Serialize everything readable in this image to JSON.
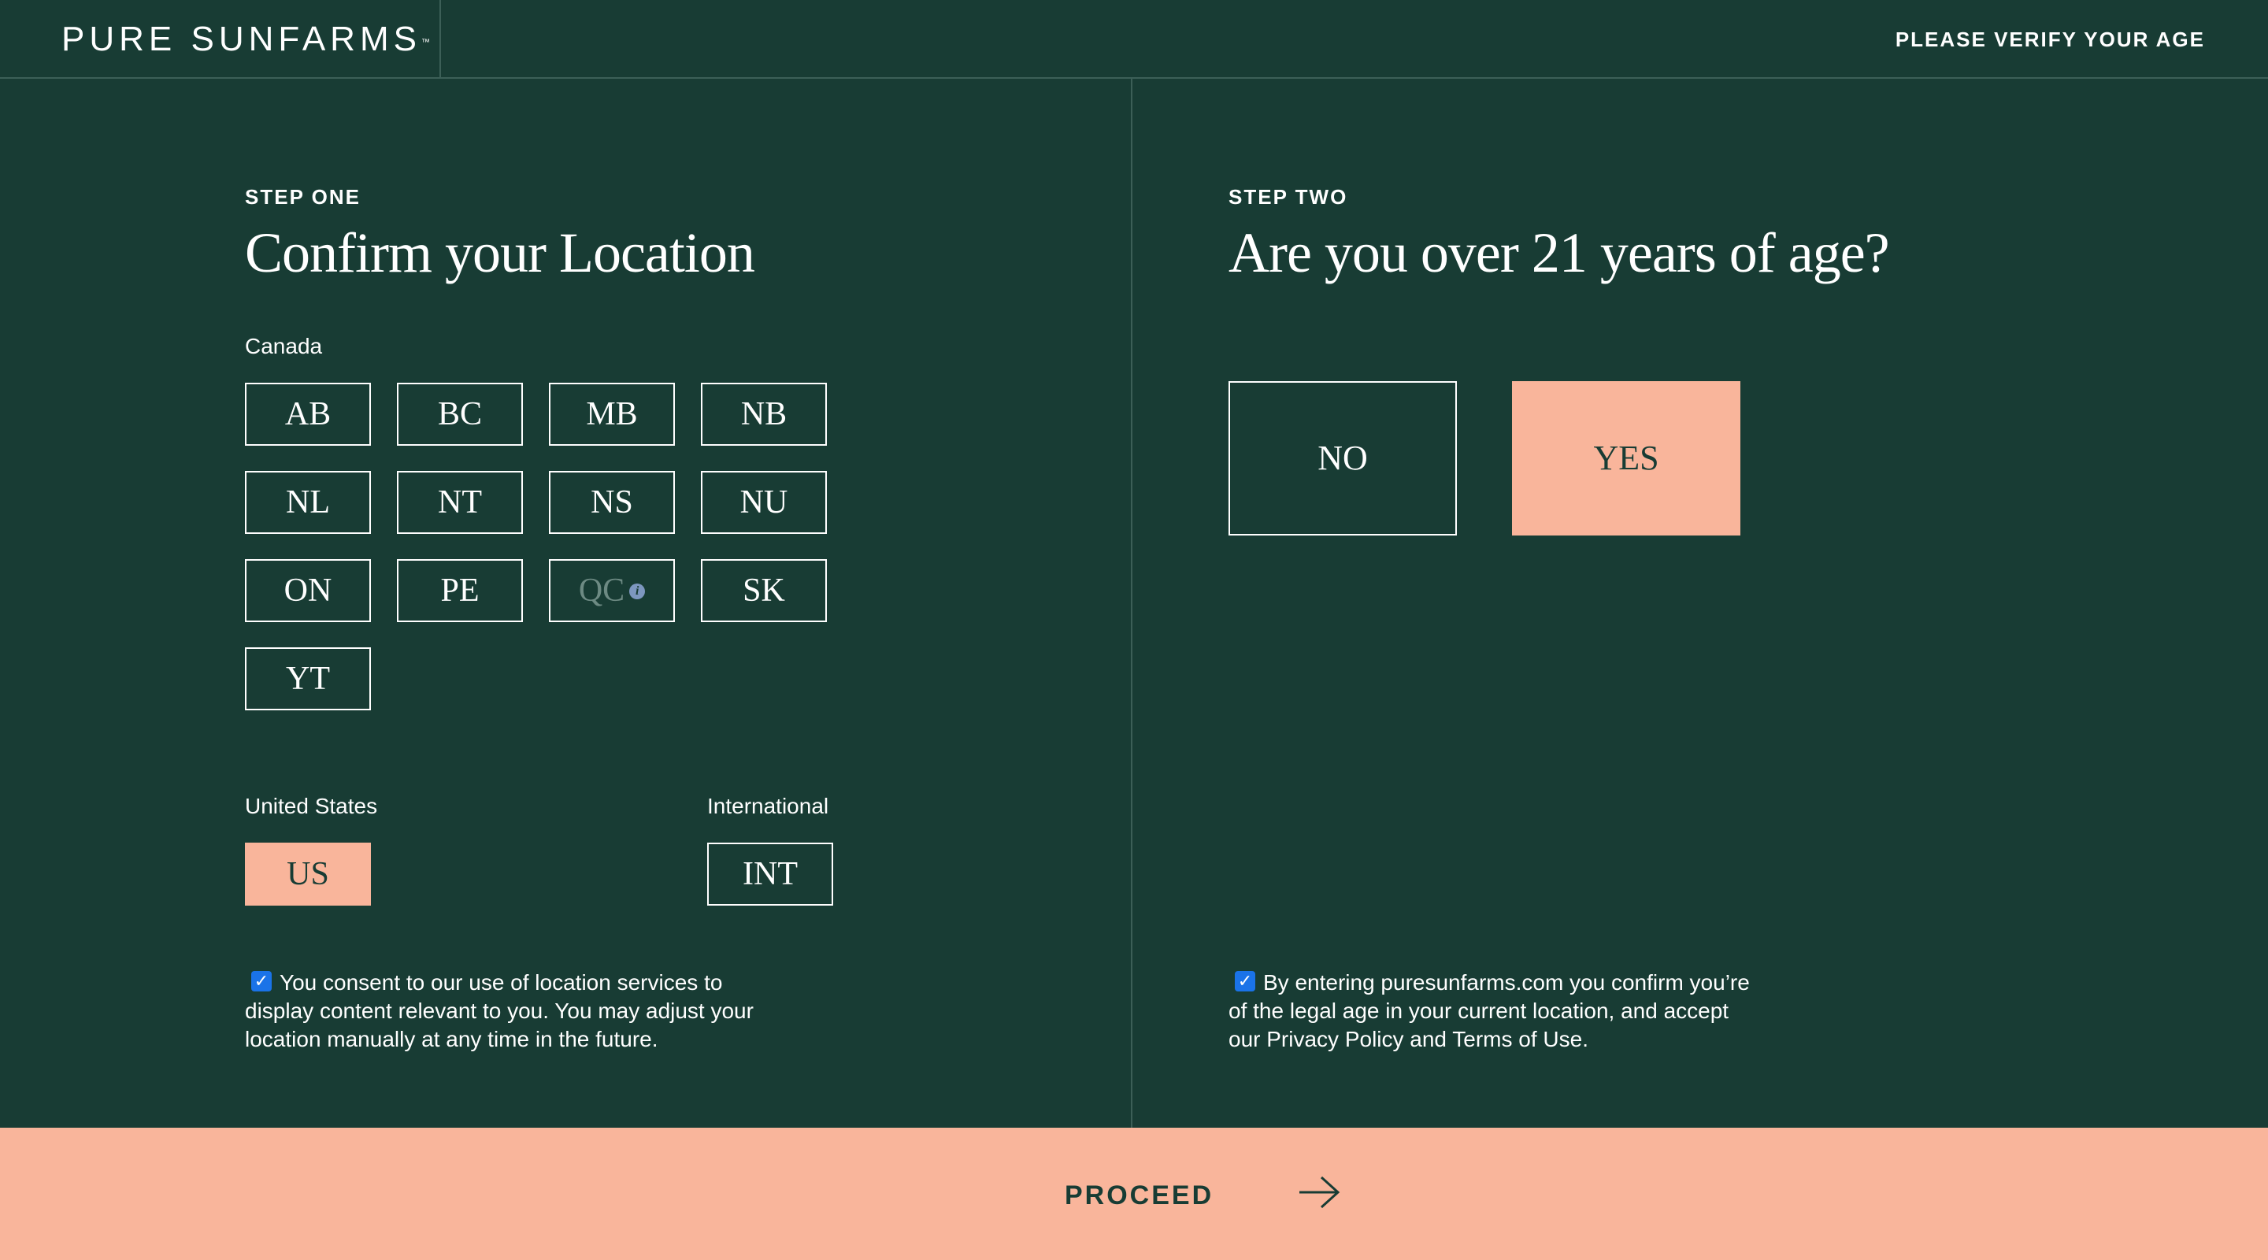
{
  "header": {
    "logo": "PURE SUNFARMS",
    "logo_mark": "™",
    "verify_text": "PLEASE VERIFY YOUR AGE"
  },
  "step_one": {
    "label": "STEP ONE",
    "title": "Confirm your Location",
    "canada": {
      "label": "Canada",
      "provinces": [
        {
          "code": "AB",
          "state": "default"
        },
        {
          "code": "BC",
          "state": "default"
        },
        {
          "code": "MB",
          "state": "default"
        },
        {
          "code": "NB",
          "state": "default"
        },
        {
          "code": "NL",
          "state": "default"
        },
        {
          "code": "NT",
          "state": "default"
        },
        {
          "code": "NS",
          "state": "default"
        },
        {
          "code": "NU",
          "state": "default"
        },
        {
          "code": "ON",
          "state": "default"
        },
        {
          "code": "PE",
          "state": "default"
        },
        {
          "code": "QC",
          "state": "disabled",
          "icon": "info-icon"
        },
        {
          "code": "SK",
          "state": "default"
        },
        {
          "code": "YT",
          "state": "default"
        }
      ]
    },
    "united_states": {
      "label": "United States",
      "button": "US",
      "state": "selected"
    },
    "international": {
      "label": "International",
      "button": "INT",
      "state": "default"
    },
    "consent": {
      "checked": true,
      "text": "You consent to our use of location services to display content relevant to you. You may adjust your location manually at any time in the future."
    }
  },
  "step_two": {
    "label": "STEP TWO",
    "title": "Are you over 21 years of age?",
    "no_label": "NO",
    "yes_label": "YES",
    "selected": "YES",
    "consent": {
      "checked": true,
      "text": "By entering puresunfarms.com you confirm you’re of the legal age in your current location, and accept our Privacy Policy and Terms of Use."
    }
  },
  "footer": {
    "proceed_label": "PROCEED",
    "proceed_icon": "arrow-right-icon"
  },
  "colors": {
    "background": "#183c34",
    "accent": "#f9b59b",
    "divider": "#3c5f57",
    "checkbox": "#1a73e8"
  }
}
